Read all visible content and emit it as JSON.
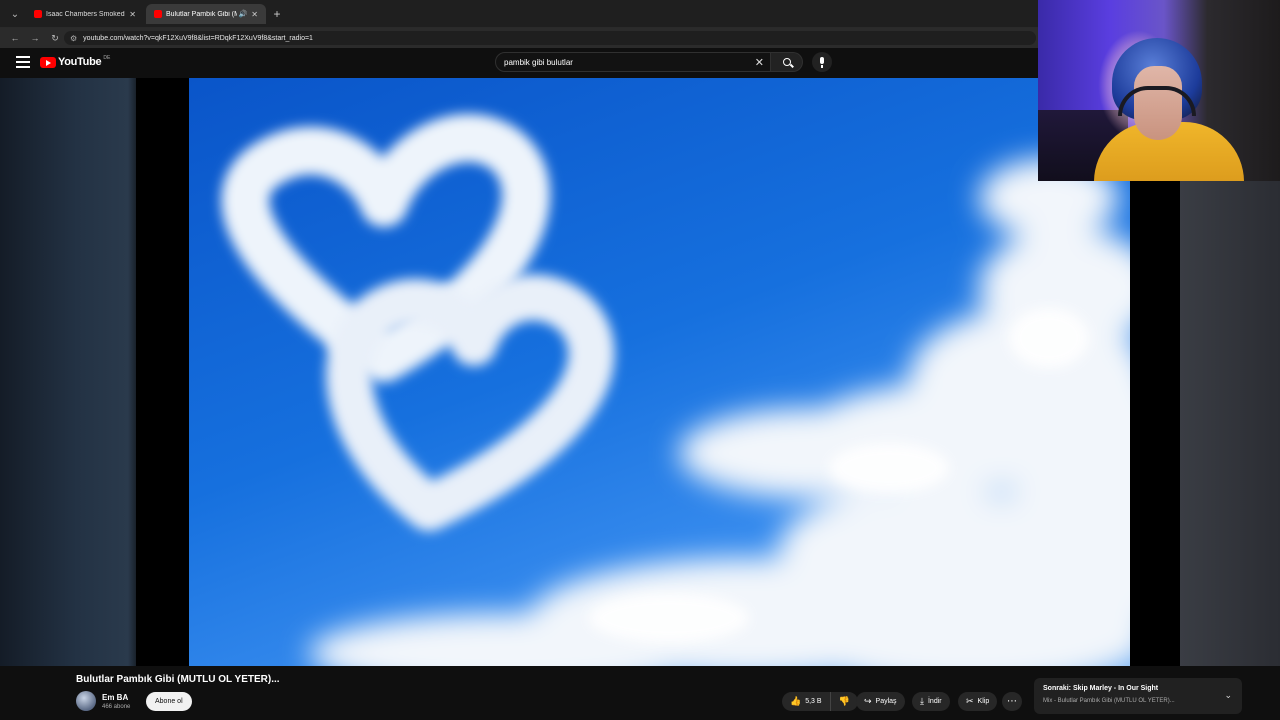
{
  "browser": {
    "tabs": [
      {
        "title": "Isaac Chambers Smoked Mood",
        "active": false
      },
      {
        "title": "Bulutlar Pambık Gibi (MUTL",
        "active": true,
        "audio": "🔊"
      }
    ],
    "url": "youtube.com/watch?v=qkF12XuV9f8&list=RDqkF12XuV9f8&start_radio=1"
  },
  "youtube": {
    "logo_text": "YouTube",
    "country_code": "DE",
    "search_value": "pambik gibi bulutlar"
  },
  "video": {
    "title": "Bulutlar Pambık Gibi (MUTLU OL YETER)...",
    "channel": "Em BA",
    "subscribers": "466 abone",
    "subscribe_label": "Abone ol",
    "likes": "5,3 B",
    "share_label": "Paylaş",
    "download_label": "İndir",
    "clip_label": "Klip"
  },
  "up_next": {
    "line1": "Sonraki: Skip Marley - In Our Sight",
    "line2": "Mix - Bulutlar Pambık Gibi (MUTLU OL YETER)..."
  },
  "colors": {
    "brand": "#ff0000",
    "sky": "#1670de",
    "shirt": "#f0b62a"
  }
}
